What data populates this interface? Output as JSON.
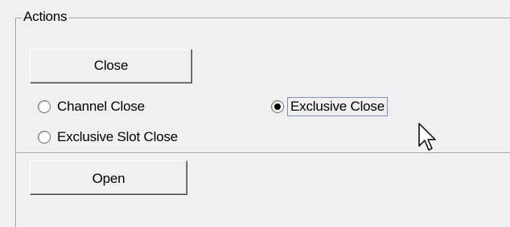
{
  "group": {
    "title": "Actions"
  },
  "buttons": {
    "close_label": "Close",
    "open_label": "Open"
  },
  "radios": [
    {
      "label": "Channel Close",
      "checked": false
    },
    {
      "label": "Exclusive Slot Close",
      "checked": false
    },
    {
      "label": "Exclusive Close",
      "checked": true,
      "focused": true
    }
  ],
  "cursor": {
    "icon": "arrow-cursor-icon"
  }
}
